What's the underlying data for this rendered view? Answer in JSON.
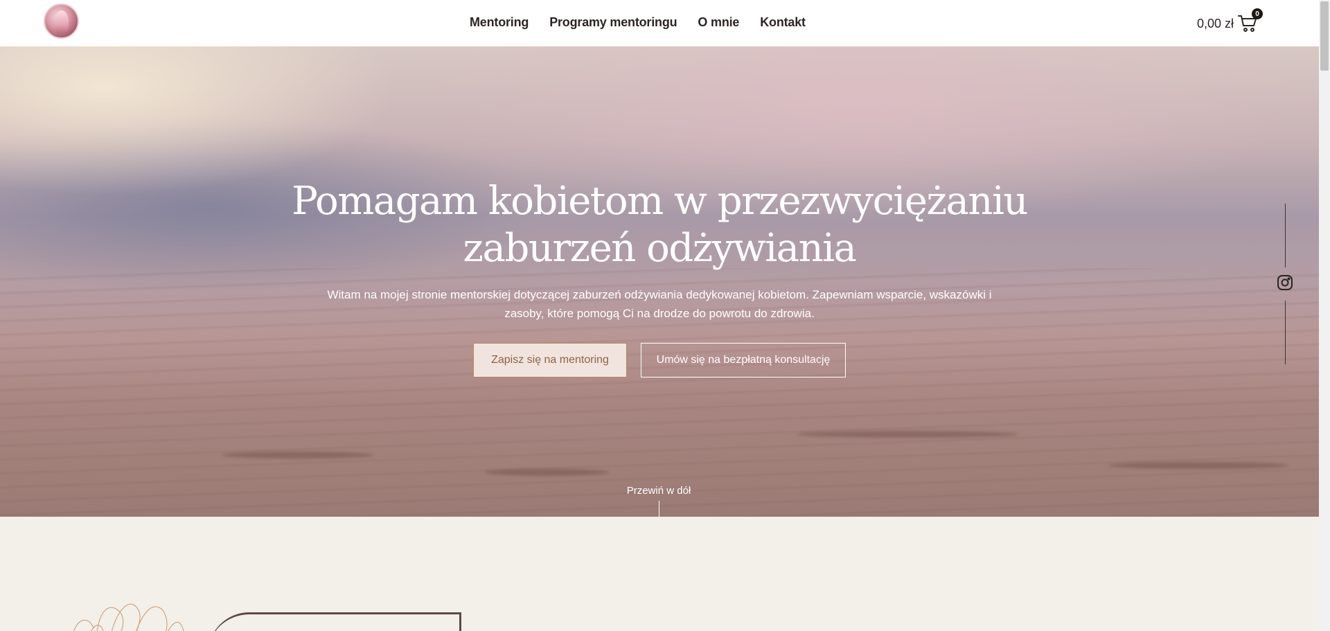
{
  "header": {
    "logo_alt": "logo",
    "nav": [
      "Mentoring",
      "Programy mentoringu",
      "O mnie",
      "Kontakt"
    ],
    "cart_total": "0,00 zł",
    "cart_count": "0"
  },
  "hero": {
    "title": "Pomagam kobietom w przezwyciężaniu zaburzeń odżywiania",
    "description": "Witam na mojej stronie mentorskiej dotyczącej zaburzeń odżywiania dedykowanej kobietom. Zapewniam wsparcie, wskazówki i zasoby, które pomogą Ci na drodze do powrotu do zdrowia.",
    "primary_button": "Zapisz się na mentoring",
    "secondary_button": "Umów się na bezpłatną konsultację",
    "scroll_label": "Przewiń w dół"
  },
  "social": {
    "icon": "instagram-icon"
  },
  "colors": {
    "accent": "#8b6247",
    "button_bg": "#f1e4de",
    "page_bg": "#f3efe9",
    "text": "#2b2523"
  }
}
